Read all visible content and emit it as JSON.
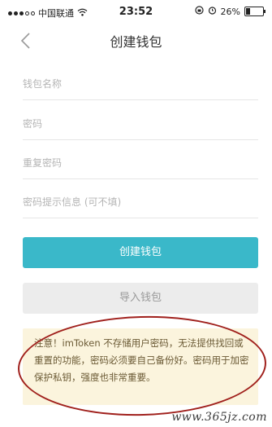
{
  "status_bar": {
    "carrier": "中国联通",
    "time": "23:52",
    "battery_text": "26%",
    "battery_level": 0.26
  },
  "nav": {
    "title": "创建钱包"
  },
  "form": {
    "wallet_name_placeholder": "钱包名称",
    "password_placeholder": "密码",
    "repeat_password_placeholder": "重复密码",
    "hint_placeholder": "密码提示信息 (可不填)"
  },
  "buttons": {
    "create_label": "创建钱包",
    "import_label": "导入钱包"
  },
  "notice": {
    "text": "注意！imToken 不存储用户密码，无法提供找回或重置的功能，密码必须要自己备份好。密码用于加密保护私钥，强度也非常重要。"
  },
  "watermark": "www.365jz.com",
  "colors": {
    "primary": "#3ab8c9",
    "notice_bg": "#fbf4dd",
    "annotation": "#a0201c"
  }
}
